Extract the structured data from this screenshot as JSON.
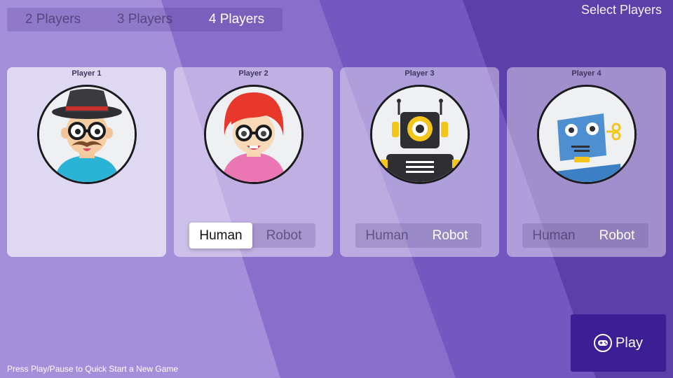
{
  "header": {
    "title": "Select Players",
    "player_count_options": [
      {
        "label": "2 Players",
        "selected": false
      },
      {
        "label": "3 Players",
        "selected": false
      },
      {
        "label": "4 Players",
        "selected": true
      }
    ]
  },
  "players": [
    {
      "label": "Player 1",
      "avatar_icon": "hipster-man-avatar-icon"
    },
    {
      "label": "Player 2",
      "avatar_icon": "red-hair-woman-avatar-icon",
      "toggle": {
        "human": "Human",
        "robot": "Robot",
        "selected": "Human"
      }
    },
    {
      "label": "Player 3",
      "avatar_icon": "yellow-robot-avatar-icon",
      "toggle": {
        "human": "Human",
        "robot": "Robot",
        "selected": "Robot"
      }
    },
    {
      "label": "Player 4",
      "avatar_icon": "blue-robot-avatar-icon",
      "toggle": {
        "human": "Human",
        "robot": "Robot",
        "selected": "Robot"
      }
    }
  ],
  "play_button": {
    "label": "Play",
    "icon": "gamepad-icon"
  },
  "footer": {
    "hint": "Press Play/Pause to Quick Start a New Game"
  },
  "colors": {
    "accent": "#3c1f95",
    "background": "#9c86d6"
  }
}
